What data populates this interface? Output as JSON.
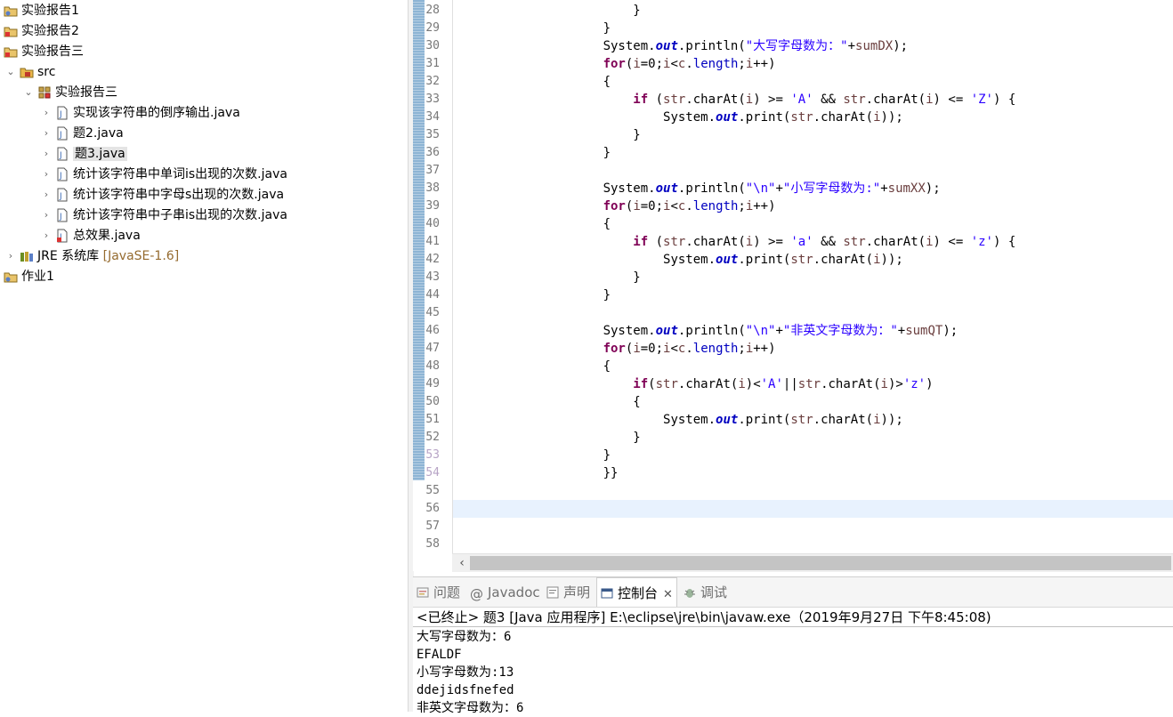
{
  "explorer": {
    "items": [
      {
        "label": "实验报告1"
      },
      {
        "label": "实验报告2"
      },
      {
        "label": "实验报告三"
      },
      {
        "label": "src"
      },
      {
        "label": "实验报告三"
      },
      {
        "label": "实现该字符串的倒序输出.java"
      },
      {
        "label": "题2.java"
      },
      {
        "label": "题3.java"
      },
      {
        "label": "统计该字符串中单词is出现的次数.java"
      },
      {
        "label": "统计该字符串中字母s出现的次数.java"
      },
      {
        "label": "统计该字符串中子串is出现的次数.java"
      },
      {
        "label": "总效果.java"
      },
      {
        "label": "JRE 系统库",
        "version": "[JavaSE-1.6]"
      },
      {
        "label": "作业1"
      }
    ]
  },
  "editor": {
    "line_numbers": [
      "28",
      "29",
      "30",
      "31",
      "32",
      "33",
      "34",
      "35",
      "36",
      "37",
      "38",
      "39",
      "40",
      "41",
      "42",
      "43",
      "44",
      "45",
      "46",
      "47",
      "48",
      "49",
      "50",
      "51",
      "52",
      "53",
      "54",
      "55",
      "56",
      "57",
      "58"
    ],
    "lines": [
      {
        "indent": "                        ",
        "parts": [
          {
            "t": "}",
            "c": ""
          }
        ]
      },
      {
        "indent": "                    ",
        "parts": [
          {
            "t": "}",
            "c": ""
          }
        ]
      },
      {
        "indent": "                    ",
        "parts": [
          {
            "t": "System.",
            "c": ""
          },
          {
            "t": "out",
            "c": "fld"
          },
          {
            "t": ".println(",
            "c": ""
          },
          {
            "t": "\"大写字母数为：\"",
            "c": "str"
          },
          {
            "t": "+",
            "c": ""
          },
          {
            "t": "sumDX",
            "c": "var"
          },
          {
            "t": ");",
            "c": ""
          }
        ]
      },
      {
        "indent": "                    ",
        "parts": [
          {
            "t": "for",
            "c": "kw"
          },
          {
            "t": "(",
            "c": ""
          },
          {
            "t": "i",
            "c": "var"
          },
          {
            "t": "=0;",
            "c": ""
          },
          {
            "t": "i",
            "c": "var"
          },
          {
            "t": "<",
            "c": ""
          },
          {
            "t": "c",
            "c": "var"
          },
          {
            "t": ".",
            "c": ""
          },
          {
            "t": "length",
            "c": "len"
          },
          {
            "t": ";",
            "c": ""
          },
          {
            "t": "i",
            "c": "var"
          },
          {
            "t": "++)",
            "c": ""
          }
        ]
      },
      {
        "indent": "                    ",
        "parts": [
          {
            "t": "{",
            "c": ""
          }
        ]
      },
      {
        "indent": "                        ",
        "parts": [
          {
            "t": "if",
            "c": "kw"
          },
          {
            "t": " (",
            "c": ""
          },
          {
            "t": "str",
            "c": "var"
          },
          {
            "t": ".charAt(",
            "c": ""
          },
          {
            "t": "i",
            "c": "var"
          },
          {
            "t": ") >= ",
            "c": ""
          },
          {
            "t": "'A'",
            "c": "str"
          },
          {
            "t": " && ",
            "c": ""
          },
          {
            "t": "str",
            "c": "var"
          },
          {
            "t": ".charAt(",
            "c": ""
          },
          {
            "t": "i",
            "c": "var"
          },
          {
            "t": ") <= ",
            "c": ""
          },
          {
            "t": "'Z'",
            "c": "str"
          },
          {
            "t": ") {",
            "c": ""
          }
        ]
      },
      {
        "indent": "                            ",
        "parts": [
          {
            "t": "System.",
            "c": ""
          },
          {
            "t": "out",
            "c": "fld"
          },
          {
            "t": ".print(",
            "c": ""
          },
          {
            "t": "str",
            "c": "var"
          },
          {
            "t": ".charAt(",
            "c": ""
          },
          {
            "t": "i",
            "c": "var"
          },
          {
            "t": "));",
            "c": ""
          }
        ]
      },
      {
        "indent": "                        ",
        "parts": [
          {
            "t": "}",
            "c": ""
          }
        ]
      },
      {
        "indent": "                    ",
        "parts": [
          {
            "t": "}",
            "c": ""
          }
        ]
      },
      {
        "indent": "",
        "parts": []
      },
      {
        "indent": "                    ",
        "parts": [
          {
            "t": "System.",
            "c": ""
          },
          {
            "t": "out",
            "c": "fld"
          },
          {
            "t": ".println(",
            "c": ""
          },
          {
            "t": "\"\\n\"",
            "c": "str"
          },
          {
            "t": "+",
            "c": ""
          },
          {
            "t": "\"小写字母数为:\"",
            "c": "str"
          },
          {
            "t": "+",
            "c": ""
          },
          {
            "t": "sumXX",
            "c": "var"
          },
          {
            "t": ");",
            "c": ""
          }
        ]
      },
      {
        "indent": "                    ",
        "parts": [
          {
            "t": "for",
            "c": "kw"
          },
          {
            "t": "(",
            "c": ""
          },
          {
            "t": "i",
            "c": "var"
          },
          {
            "t": "=0;",
            "c": ""
          },
          {
            "t": "i",
            "c": "var"
          },
          {
            "t": "<",
            "c": ""
          },
          {
            "t": "c",
            "c": "var"
          },
          {
            "t": ".",
            "c": ""
          },
          {
            "t": "length",
            "c": "len"
          },
          {
            "t": ";",
            "c": ""
          },
          {
            "t": "i",
            "c": "var"
          },
          {
            "t": "++)",
            "c": ""
          }
        ]
      },
      {
        "indent": "                    ",
        "parts": [
          {
            "t": "{",
            "c": ""
          }
        ]
      },
      {
        "indent": "                        ",
        "parts": [
          {
            "t": "if",
            "c": "kw"
          },
          {
            "t": " (",
            "c": ""
          },
          {
            "t": "str",
            "c": "var"
          },
          {
            "t": ".charAt(",
            "c": ""
          },
          {
            "t": "i",
            "c": "var"
          },
          {
            "t": ") >= ",
            "c": ""
          },
          {
            "t": "'a'",
            "c": "str"
          },
          {
            "t": " && ",
            "c": ""
          },
          {
            "t": "str",
            "c": "var"
          },
          {
            "t": ".charAt(",
            "c": ""
          },
          {
            "t": "i",
            "c": "var"
          },
          {
            "t": ") <= ",
            "c": ""
          },
          {
            "t": "'z'",
            "c": "str"
          },
          {
            "t": ") {",
            "c": ""
          }
        ]
      },
      {
        "indent": "                            ",
        "parts": [
          {
            "t": "System.",
            "c": ""
          },
          {
            "t": "out",
            "c": "fld"
          },
          {
            "t": ".print(",
            "c": ""
          },
          {
            "t": "str",
            "c": "var"
          },
          {
            "t": ".charAt(",
            "c": ""
          },
          {
            "t": "i",
            "c": "var"
          },
          {
            "t": "));",
            "c": ""
          }
        ]
      },
      {
        "indent": "                        ",
        "parts": [
          {
            "t": "}",
            "c": ""
          }
        ]
      },
      {
        "indent": "                    ",
        "parts": [
          {
            "t": "}",
            "c": ""
          }
        ]
      },
      {
        "indent": "",
        "parts": []
      },
      {
        "indent": "                    ",
        "parts": [
          {
            "t": "System.",
            "c": ""
          },
          {
            "t": "out",
            "c": "fld"
          },
          {
            "t": ".println(",
            "c": ""
          },
          {
            "t": "\"\\n\"",
            "c": "str"
          },
          {
            "t": "+",
            "c": ""
          },
          {
            "t": "\"非英文字母数为：\"",
            "c": "str"
          },
          {
            "t": "+",
            "c": ""
          },
          {
            "t": "sumQT",
            "c": "var"
          },
          {
            "t": ");",
            "c": ""
          }
        ]
      },
      {
        "indent": "                    ",
        "parts": [
          {
            "t": "for",
            "c": "kw"
          },
          {
            "t": "(",
            "c": ""
          },
          {
            "t": "i",
            "c": "var"
          },
          {
            "t": "=0;",
            "c": ""
          },
          {
            "t": "i",
            "c": "var"
          },
          {
            "t": "<",
            "c": ""
          },
          {
            "t": "c",
            "c": "var"
          },
          {
            "t": ".",
            "c": ""
          },
          {
            "t": "length",
            "c": "len"
          },
          {
            "t": ";",
            "c": ""
          },
          {
            "t": "i",
            "c": "var"
          },
          {
            "t": "++)",
            "c": ""
          }
        ]
      },
      {
        "indent": "                    ",
        "parts": [
          {
            "t": "{",
            "c": ""
          }
        ]
      },
      {
        "indent": "                        ",
        "parts": [
          {
            "t": "if",
            "c": "kw"
          },
          {
            "t": "(",
            "c": ""
          },
          {
            "t": "str",
            "c": "var"
          },
          {
            "t": ".charAt(",
            "c": ""
          },
          {
            "t": "i",
            "c": "var"
          },
          {
            "t": ")<",
            "c": ""
          },
          {
            "t": "'A'",
            "c": "str"
          },
          {
            "t": "||",
            "c": ""
          },
          {
            "t": "str",
            "c": "var"
          },
          {
            "t": ".charAt(",
            "c": ""
          },
          {
            "t": "i",
            "c": "var"
          },
          {
            "t": ")>",
            "c": ""
          },
          {
            "t": "'z'",
            "c": "str"
          },
          {
            "t": ")",
            "c": ""
          }
        ]
      },
      {
        "indent": "                        ",
        "parts": [
          {
            "t": "{",
            "c": ""
          }
        ]
      },
      {
        "indent": "                            ",
        "parts": [
          {
            "t": "System.",
            "c": ""
          },
          {
            "t": "out",
            "c": "fld"
          },
          {
            "t": ".print(",
            "c": ""
          },
          {
            "t": "str",
            "c": "var"
          },
          {
            "t": ".charAt(",
            "c": ""
          },
          {
            "t": "i",
            "c": "var"
          },
          {
            "t": "));",
            "c": ""
          }
        ]
      },
      {
        "indent": "                        ",
        "parts": [
          {
            "t": "}",
            "c": ""
          }
        ]
      },
      {
        "indent": "                    ",
        "parts": [
          {
            "t": "}",
            "c": ""
          }
        ]
      },
      {
        "indent": "                    ",
        "parts": [
          {
            "t": "}}",
            "c": ""
          }
        ]
      },
      {
        "indent": "",
        "parts": []
      },
      {
        "indent": "",
        "parts": []
      },
      {
        "indent": "",
        "parts": []
      },
      {
        "indent": "",
        "parts": []
      }
    ]
  },
  "console": {
    "tabs": [
      {
        "label": "问题",
        "icon": "problems-icon"
      },
      {
        "label": "Javadoc",
        "icon": "at-icon"
      },
      {
        "label": "声明",
        "icon": "declaration-icon"
      },
      {
        "label": "控制台",
        "icon": "console-icon",
        "active": true
      },
      {
        "label": "调试",
        "icon": "debug-icon"
      }
    ],
    "status": "<已终止> 题3 [Java 应用程序] E:\\eclipse\\jre\\bin\\javaw.exe（2019年9月27日 下午8:45:08)",
    "output": [
      "大写字母数为：6",
      "EFALDF",
      "小写字母数为:13",
      "ddejidsfnefed",
      "非英文字母数为：6"
    ]
  },
  "colors": {
    "keyword": "#7f0055",
    "string": "#2a00ff",
    "field": "#0000c0",
    "current_line": "#e8f2fe"
  }
}
